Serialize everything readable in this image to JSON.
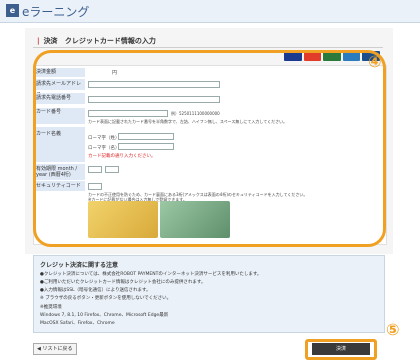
{
  "header": {
    "logo_glyph": "e",
    "title": "eラーニング"
  },
  "page": {
    "section_marker": "|",
    "section_label": "決済",
    "section_title": "クレジットカード情報の入力"
  },
  "card_brands": [
    {
      "name": "visa",
      "color": "#1a3a8f"
    },
    {
      "name": "mastercard",
      "color": "#e23b2a"
    },
    {
      "name": "jcb",
      "color": "#2a7a3b"
    },
    {
      "name": "amex",
      "color": "#2b7bbf"
    },
    {
      "name": "diners",
      "color": "#1b4e8a"
    }
  ],
  "form": {
    "amount_label": "決済金額",
    "amount_unit": "円",
    "email_label": "請求先メールアドレス",
    "phone_label": "請求先電話番号",
    "card_number_label": "カード番号",
    "card_number_example": "例）5250111100000000",
    "card_number_note": "カード表面に記載されたカード番号を半角数字で、左詰、ハイフン無し、スペース無しにて入力してください。",
    "holder_label": "カード名義",
    "holder_last_label": "ローマ字（姓）",
    "holder_first_label": "ローマ字（名）",
    "holder_note": "カード記載の通り入力ください。",
    "expiry_label": "有効期限 month / year (西暦4桁)",
    "security_label": "セキュリティコード",
    "security_note": "カードの不正使用を防ぐため、カード裏面にある3桁(アメックスは表面の4桁)のセキュリティコードを入力してください。",
    "security_note2": "※カードに記載がない場合は入力無しで登録できます。"
  },
  "callouts": {
    "form": "④",
    "pay": "⑤"
  },
  "notice": {
    "heading": "クレジット決済に関する注意",
    "lines": [
      "●クレジット決済については、株式会社ROBOT PAYMENTのインターネット決済サービスを利用いたします。",
      "●ご利用いただいたクレジットカード情報はクレジット会社にのみ提供されます。",
      "●入力情報はSSL（暗号化通信）により送信されます。",
      "※ ブラウザの戻るボタン・更新ボタンを使用しないでください。",
      "※推奨環境",
      "Windows  7, 8.1, 10    Firefox、Chrome、Microsoft Edge最新",
      "MacOSX                 Safari、Firefox、Chrome"
    ]
  },
  "buttons": {
    "back": "リストに戻る",
    "pay": "決済"
  }
}
